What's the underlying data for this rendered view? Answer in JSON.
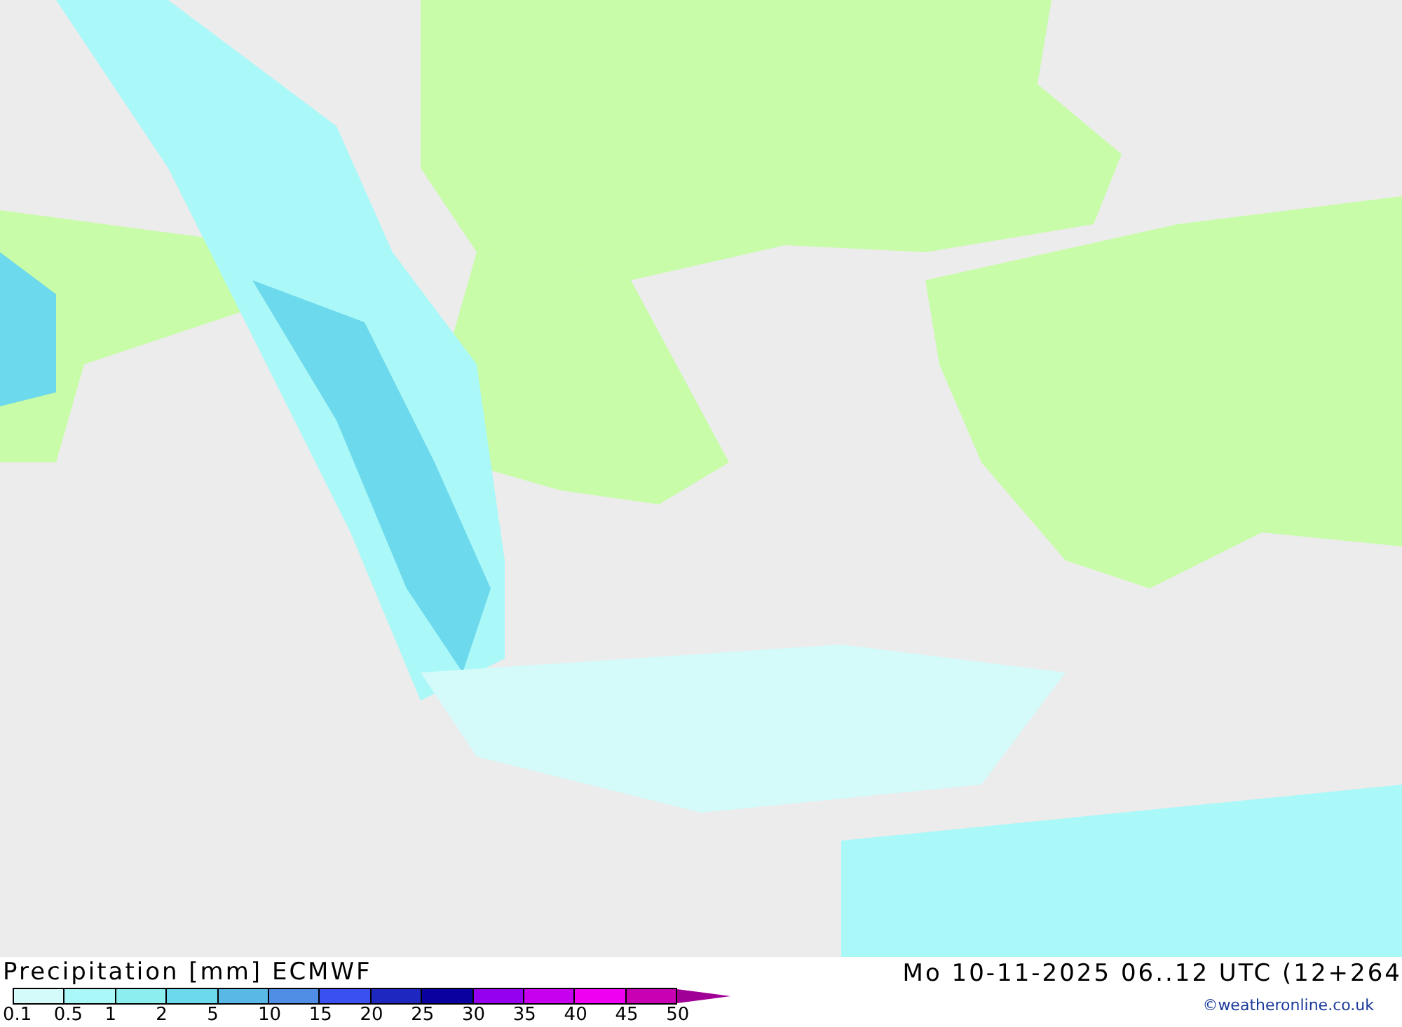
{
  "title": "Precipitation [mm] ECMWF",
  "valid_time": "Mo 10-11-2025 06..12 UTC (12+264",
  "legend": {
    "swatches": [
      {
        "color": "#d4fafa"
      },
      {
        "color": "#aaf8f8"
      },
      {
        "color": "#8ceeee"
      },
      {
        "color": "#6cd9ec"
      },
      {
        "color": "#5ab8e6"
      },
      {
        "color": "#508ee6"
      },
      {
        "color": "#3a50f0"
      },
      {
        "color": "#1e28c0"
      },
      {
        "color": "#0a00a0"
      },
      {
        "color": "#9600f0"
      },
      {
        "color": "#c800f0"
      },
      {
        "color": "#f000f0"
      },
      {
        "color": "#c800b4"
      },
      {
        "kind": "arrow",
        "color": "#a00096"
      }
    ],
    "ticks": [
      "0.1",
      "0.5",
      "1",
      "2",
      "5",
      "10",
      "15",
      "20",
      "25",
      "30",
      "35",
      "40",
      "45",
      "50"
    ]
  },
  "credit": "©weatheronline.co.uk"
}
